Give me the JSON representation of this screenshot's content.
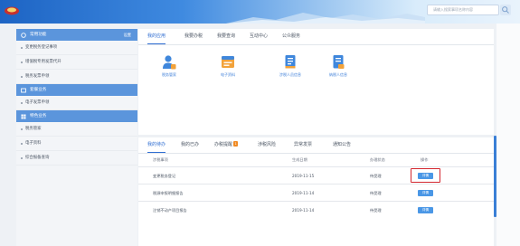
{
  "header": {
    "search_placeholder": "请输入搜索事项名称内容"
  },
  "sidebar": {
    "sections": [
      {
        "title": "常用功能",
        "more": "设置",
        "items": [
          "变更税务登记事项",
          "增值税专用发票代开",
          "税务发票申领"
        ]
      },
      {
        "title": "套餐业务",
        "items": [
          "电子发票申领"
        ]
      },
      {
        "title": "特色业务",
        "items": [
          "税务管家",
          "电子资料",
          "综合报备查询"
        ]
      }
    ]
  },
  "top_panel": {
    "tabs": [
      "我的应用",
      "我要办税",
      "我要查询",
      "互动中心",
      "公众服务"
    ],
    "functions": [
      {
        "icon": "user-manage-icon",
        "label": "税务管家"
      },
      {
        "icon": "electronic-data-icon",
        "label": "电子资料"
      },
      {
        "icon": "taxpayer-list-icon",
        "label": "涉税人员信息"
      },
      {
        "icon": "taxpayer-info-icon",
        "label": "纳税人信息"
      }
    ]
  },
  "todo_panel": {
    "tabs": [
      "我的待办",
      "我的已办",
      "办税提醒",
      "涉税风险",
      "异常发票",
      "通知公告"
    ],
    "reminder_badge": "1",
    "columns": [
      "涉税事项",
      "生成日期",
      "办理状态",
      "操作"
    ],
    "rows": [
      {
        "item": "变更税务登记",
        "date": "2019-11-15",
        "status": "待受理",
        "action": "详情"
      },
      {
        "item": "税源申报明细报告",
        "date": "2019-11-14",
        "status": "待受理",
        "action": "详情"
      },
      {
        "item": "注销不动产项目报告",
        "date": "2019-11-14",
        "status": "待受理",
        "action": "详情"
      }
    ]
  },
  "colors": {
    "accent": "#2f6ed2",
    "sidebar_header": "#5b95dc",
    "action_button": "#4a97e6",
    "highlight": "#d3262e",
    "badge": "#f08a24"
  }
}
